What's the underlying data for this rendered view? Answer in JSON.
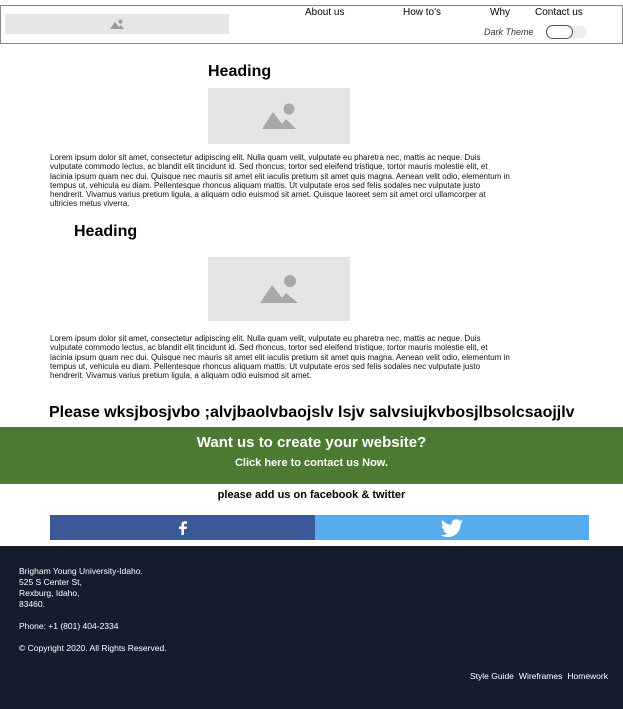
{
  "header": {
    "logo_icon": "image-placeholder-icon",
    "nav": [
      "About us",
      "How to's",
      "Why",
      "Contact us"
    ],
    "dark_theme_label": "Dark Theme",
    "dark_theme_on": false
  },
  "sections": [
    {
      "heading": "Heading",
      "image_icon": "image-placeholder-icon",
      "text": "Lorem ipsum dolor sit amet, consectetur adipiscing elit. Nulla quam velit, vulputate eu pharetra nec, mattis ac neque. Duis vulputate commodo lectus, ac blandit elit tincidunt id. Sed rhoncus, tortor sed eleifend tristique, tortor mauris molestie elit, et lacinia ipsum quam nec dui. Quisque nec mauris sit amet elit iaculis pretium sit amet quis magna. Aenean velit odio, elementum in tempus ut, vehicula eu diam. Pellentesque rhoncus aliquam mattis. Ut vulputate eros sed felis sodales nec vulputate justo hendrerit. Vivamus varius pretium ligula, a aliquam odio euismod sit amet. Quisque laoreet sem sit amet orci ullamcorper at ultricies metus viverra."
    },
    {
      "heading": "Heading",
      "image_icon": "image-placeholder-icon",
      "text": "Lorem ipsum dolor sit amet, consectetur adipiscing elit. Nulla quam velit, vulputate eu pharetra nec, mattis ac neque. Duis vulputate commodo lectus, ac blandit elit tincidunt id. Sed rhoncus, tortor sed eleifend tristique, tortor mauris molestie elit, et lacinia ipsum quam nec dui. Quisque nec mauris sit amet elit iaculis pretium sit amet quis magna. Aenean velit odio, elementum in tempus ut, vehicula eu diam. Pellentesque rhoncus aliquam mattis. Ut vulputate eros sed felis sodales nec vulputate justo hendrerit. Vivamus varius pretium ligula, a aliquam odio euismod sit amet."
    }
  ],
  "banner_text": "Please wksjbosjvbo ;alvjbaolvbaojslv lsjv salvsiujkvbosjlbsolcsaojjlv",
  "cta": {
    "title": "Want us to create your website?",
    "link": "Click here to contact us Now.",
    "color": "#4c7a32"
  },
  "social": {
    "text": "please add us on facebook & twitter",
    "facebook_icon": "facebook-icon",
    "twitter_icon": "twitter-icon",
    "facebook_color": "#3b5998",
    "twitter_color": "#55acee"
  },
  "footer": {
    "address": [
      "Brigham Young University-Idaho.",
      "525 S Center St,",
      "Rexburg, Idaho,",
      "83460."
    ],
    "phone": "Phone: +1 (801) 404-2334",
    "copyright": "© Copyright 2020. All Rights Reserved.",
    "links": [
      "Style Guide",
      "Wireframes",
      "Homework"
    ],
    "background": "#141d2e"
  }
}
